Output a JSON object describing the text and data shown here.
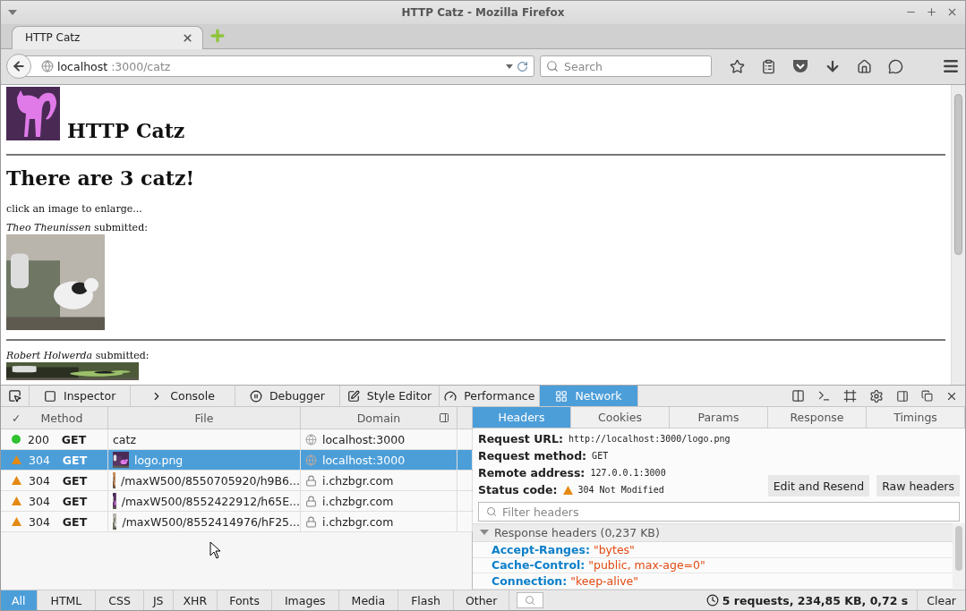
{
  "window": {
    "title": "HTTP Catz - Mozilla Firefox"
  },
  "tabs": [
    {
      "label": "HTTP Catz",
      "selected": true
    }
  ],
  "address_bar": {
    "host": "localhost",
    "path": ":3000/catz"
  },
  "search": {
    "placeholder": "Search"
  },
  "page": {
    "site_title": "HTTP Catz",
    "heading": "There are 3 catz!",
    "hint": "click an image to enlarge...",
    "submissions": [
      {
        "author": "Theo Theunissen",
        "text": "submitted:"
      },
      {
        "author": "Robert Holwerda",
        "text": "submitted:"
      }
    ]
  },
  "devtools": {
    "tools": [
      {
        "label": "Inspector",
        "selected": false
      },
      {
        "label": "Console",
        "selected": false
      },
      {
        "label": "Debugger",
        "selected": false
      },
      {
        "label": "Style Editor",
        "selected": false
      },
      {
        "label": "Performance",
        "selected": false
      },
      {
        "label": "Network",
        "selected": true
      }
    ],
    "network": {
      "columns": [
        "✓",
        "Method",
        "File",
        "Domain"
      ],
      "requests": [
        {
          "status": "200",
          "kind": "ok",
          "method": "GET",
          "file": "catz",
          "domain": "localhost:3000",
          "secure": false,
          "selected": false
        },
        {
          "status": "304",
          "kind": "cached",
          "method": "GET",
          "file": "logo.png",
          "domain": "localhost:3000",
          "secure": false,
          "selected": true
        },
        {
          "status": "304",
          "kind": "cached",
          "method": "GET",
          "file": "/maxW500/8550705920/h9B6...",
          "domain": "i.chzbgr.com",
          "secure": true,
          "selected": false
        },
        {
          "status": "304",
          "kind": "cached",
          "method": "GET",
          "file": "/maxW500/8552422912/h65E...",
          "domain": "i.chzbgr.com",
          "secure": true,
          "selected": false
        },
        {
          "status": "304",
          "kind": "cached",
          "method": "GET",
          "file": "/maxW500/8552414976/hF25...",
          "domain": "i.chzbgr.com",
          "secure": true,
          "selected": false
        }
      ]
    },
    "details": {
      "tabs": [
        {
          "label": "Headers",
          "selected": true
        },
        {
          "label": "Cookies",
          "selected": false
        },
        {
          "label": "Params",
          "selected": false
        },
        {
          "label": "Response",
          "selected": false
        },
        {
          "label": "Timings",
          "selected": false
        }
      ],
      "summary": [
        {
          "label": "Request URL:",
          "value": "http://localhost:3000/logo.png"
        },
        {
          "label": "Request method:",
          "value": "GET"
        },
        {
          "label": "Remote address:",
          "value": "127.0.0.1:3000"
        },
        {
          "label": "Status code:",
          "value": "304 Not Modified",
          "kind": "cached"
        }
      ],
      "buttons": [
        "Edit and Resend",
        "Raw headers"
      ],
      "filter": {
        "placeholder": "Filter headers"
      },
      "section": {
        "title": "Response headers (0,237 KB)",
        "expanded": true,
        "headers": [
          {
            "name": "Accept-Ranges:",
            "value": "\"bytes\""
          },
          {
            "name": "Cache-Control:",
            "value": "\"public, max-age=0\""
          },
          {
            "name": "Connection:",
            "value": "\"keep-alive\""
          }
        ]
      }
    },
    "filters": [
      {
        "label": "All",
        "selected": true
      },
      {
        "label": "HTML",
        "selected": false
      },
      {
        "label": "CSS",
        "selected": false
      },
      {
        "label": "JS",
        "selected": false
      },
      {
        "label": "XHR",
        "selected": false
      },
      {
        "label": "Fonts",
        "selected": false
      },
      {
        "label": "Images",
        "selected": false
      },
      {
        "label": "Media",
        "selected": false
      },
      {
        "label": "Flash",
        "selected": false
      },
      {
        "label": "Other",
        "selected": false
      }
    ],
    "summary": "5 requests, 234,85 KB, 0,72 s",
    "clear": "Clear"
  }
}
